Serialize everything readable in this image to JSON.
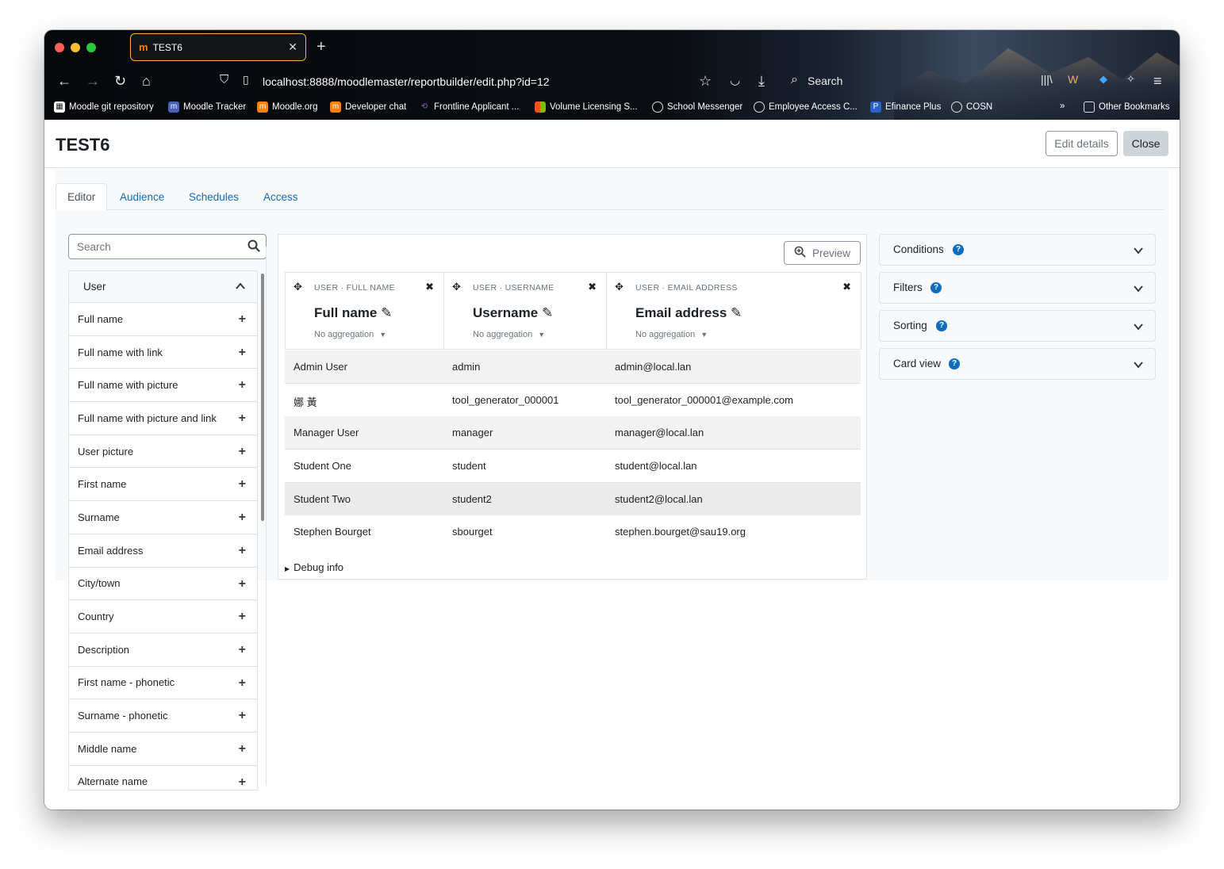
{
  "browser": {
    "tab_title": "TEST6",
    "url": "localhost:8888/moodlemaster/reportbuilder/edit.php?id=12",
    "search_label": "Search",
    "bookmarks": [
      {
        "label": "Moodle git repository"
      },
      {
        "label": "Moodle Tracker"
      },
      {
        "label": "Moodle.org"
      },
      {
        "label": "Developer chat"
      },
      {
        "label": "Frontline Applicant ..."
      },
      {
        "label": "Volume Licensing S..."
      },
      {
        "label": "School Messenger"
      },
      {
        "label": "Employee Access C..."
      },
      {
        "label": "Efinance Plus"
      },
      {
        "label": "COSN"
      }
    ],
    "other_bookmarks": "Other Bookmarks"
  },
  "page": {
    "title": "TEST6",
    "edit_details": "Edit details",
    "close": "Close"
  },
  "tabs": [
    {
      "label": "Editor"
    },
    {
      "label": "Audience"
    },
    {
      "label": "Schedules"
    },
    {
      "label": "Access"
    }
  ],
  "sidebar": {
    "search_placeholder": "Search",
    "group": "User",
    "items": [
      "Full name",
      "Full name with link",
      "Full name with picture",
      "Full name with picture and link",
      "User picture",
      "First name",
      "Surname",
      "Email address",
      "City/town",
      "Country",
      "Description",
      "First name - phonetic",
      "Surname - phonetic",
      "Middle name",
      "Alternate name"
    ]
  },
  "report": {
    "preview": "Preview",
    "columns": [
      {
        "source": "USER · FULL NAME",
        "name": "Full name",
        "aggregation": "No aggregation"
      },
      {
        "source": "USER · USERNAME",
        "name": "Username",
        "aggregation": "No aggregation"
      },
      {
        "source": "USER · EMAIL ADDRESS",
        "name": "Email address",
        "aggregation": "No aggregation"
      }
    ],
    "rows": [
      [
        "Admin User",
        "admin",
        "admin@local.lan"
      ],
      [
        "娜 黃",
        "tool_generator_000001",
        "tool_generator_000001@example.com"
      ],
      [
        "Manager User",
        "manager",
        "manager@local.lan"
      ],
      [
        "Student One",
        "student",
        "student@local.lan"
      ],
      [
        "Student Two",
        "student2",
        "student2@local.lan"
      ],
      [
        "Stephen Bourget",
        "sbourget",
        "stephen.bourget@sau19.org"
      ]
    ],
    "debug": "Debug info"
  },
  "panels": [
    {
      "label": "Conditions"
    },
    {
      "label": "Filters"
    },
    {
      "label": "Sorting"
    },
    {
      "label": "Card view"
    }
  ],
  "colors": {
    "link": "#0f6cbf",
    "border": "#dee2e6",
    "stripe": "#f2f2f2",
    "hover": "#ebebeb"
  }
}
